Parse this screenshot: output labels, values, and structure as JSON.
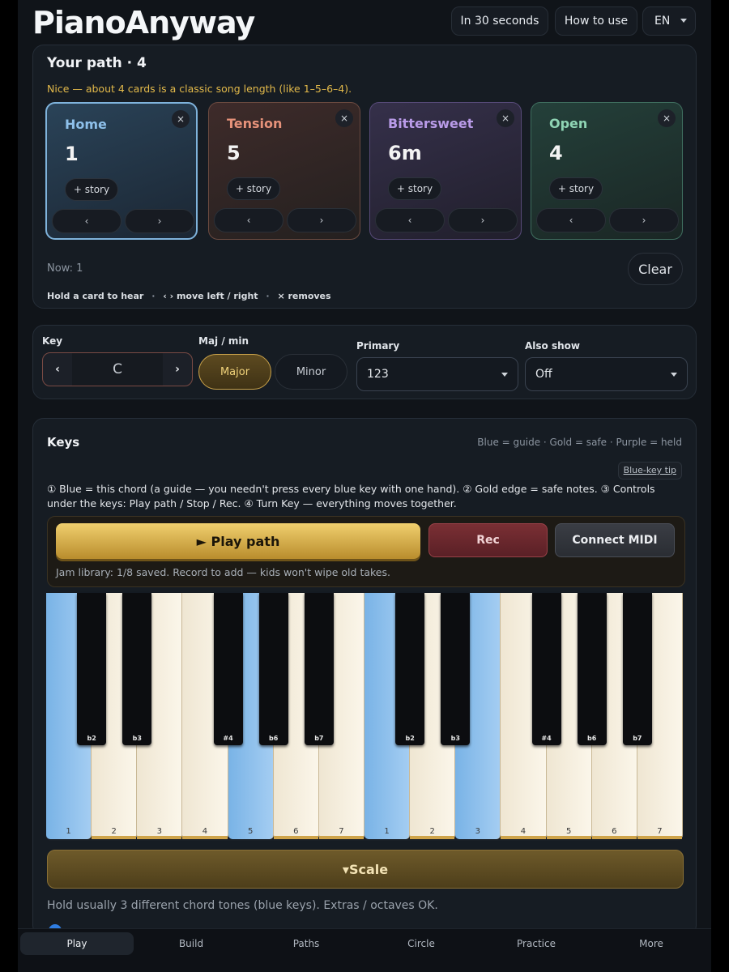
{
  "header": {
    "logo": "PianoAnyway",
    "btn_30s": "In 30 seconds",
    "btn_howto": "How to use",
    "lang": "EN"
  },
  "path": {
    "title": "Your path · 4",
    "hint": "Nice — about 4 cards is a classic song length (like 1–5–6–4).",
    "cards": [
      {
        "name": "Home",
        "num": "1",
        "story": "+ story",
        "x": "×",
        "prev": "‹",
        "next": "›",
        "color": "#8ec0ea"
      },
      {
        "name": "Tension",
        "num": "5",
        "story": "+ story",
        "x": "×",
        "prev": "‹",
        "next": "›",
        "color": "#e6927a"
      },
      {
        "name": "Bittersweet",
        "num": "6m",
        "story": "+ story",
        "x": "×",
        "prev": "‹",
        "next": "›",
        "color": "#b99be8"
      },
      {
        "name": "Open",
        "num": "4",
        "story": "+ story",
        "x": "×",
        "prev": "‹",
        "next": "›",
        "color": "#8fd4b4"
      }
    ],
    "now": "Now: 1",
    "clear": "Clear",
    "help1": "Hold a card to hear",
    "help_sep1": "·",
    "help2": "‹ › move left / right",
    "help_sep2": "·",
    "help3": "× removes"
  },
  "controls": {
    "key_label": "Key",
    "key_prev": "‹",
    "key_value": "C",
    "key_next": "›",
    "majmin_label": "Maj / min",
    "major": "Major",
    "minor": "Minor",
    "primary_label": "Primary",
    "primary_value": "123",
    "also_label": "Also show",
    "also_value": "Off"
  },
  "keys": {
    "title": "Keys",
    "legend": "Blue = guide · Gold = safe · Purple = held",
    "tip": "Blue-key tip",
    "instructions": "① Blue = this chord (a guide — you needn't press every blue key with one hand). ② Gold edge = safe notes. ③ Controls under the keys: Play path / Stop / Rec. ④ Turn Key — everything moves together.",
    "play": "► Play path",
    "rec": "Rec",
    "midi": "Connect MIDI",
    "jam": "Jam library: 1/8 saved. Record to add — kids won't wipe old takes.",
    "white_keys": [
      {
        "label": "1",
        "state": "blue"
      },
      {
        "label": "2",
        "state": "gold"
      },
      {
        "label": "3",
        "state": "gold"
      },
      {
        "label": "4",
        "state": "gold"
      },
      {
        "label": "5",
        "state": "blue"
      },
      {
        "label": "6",
        "state": "gold"
      },
      {
        "label": "7",
        "state": "gold"
      },
      {
        "label": "1",
        "state": "blue"
      },
      {
        "label": "2",
        "state": "gold"
      },
      {
        "label": "3",
        "state": "blue"
      },
      {
        "label": "4",
        "state": "gold"
      },
      {
        "label": "5",
        "state": "gold"
      },
      {
        "label": "6",
        "state": "gold"
      },
      {
        "label": "7",
        "state": "gold"
      }
    ],
    "black_keys": [
      {
        "label": "b2",
        "after": 0
      },
      {
        "label": "b3",
        "after": 1
      },
      {
        "label": "#4",
        "after": 3
      },
      {
        "label": "b6",
        "after": 4
      },
      {
        "label": "b7",
        "after": 5
      },
      {
        "label": "b2",
        "after": 7
      },
      {
        "label": "b3",
        "after": 8
      },
      {
        "label": "#4",
        "after": 10
      },
      {
        "label": "b6",
        "after": 11
      },
      {
        "label": "b7",
        "after": 12
      }
    ],
    "scale": "▾Scale",
    "footer": "Hold usually 3 different chord tones (blue keys). Extras / octaves OK."
  },
  "tabs": [
    "Play",
    "Build",
    "Paths",
    "Circle",
    "Practice",
    "More"
  ],
  "colors": {
    "gold": "#e2b94a",
    "blue": "#8cc0ec",
    "bg": "#101419"
  }
}
